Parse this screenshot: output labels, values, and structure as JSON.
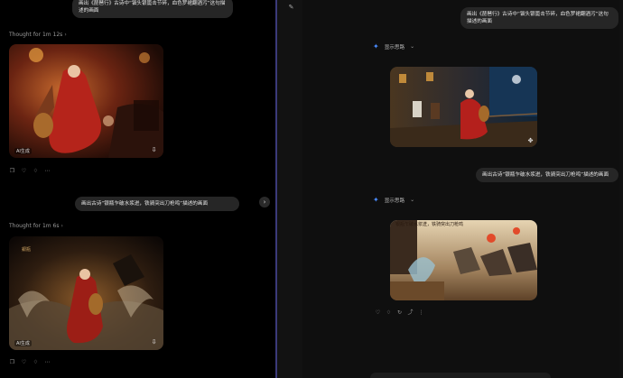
{
  "left": {
    "prompt1": "画出《琵琶行》古诗中“钿头银篦击节碎，血色罗裙翻酒污”这句描述的画面",
    "thought1": "Thought for 1m 12s",
    "thought_chevron": "›",
    "watermark": "AI生成",
    "prompt2": "画出古诗“银瓶乍破水浆迸，铁骑突出刀枪鸣”描述的画面",
    "thought2": "Thought for 1m 6s",
    "side_arrow": "›"
  },
  "right": {
    "prompt1": "画出《琵琶行》古诗中“钿头银篦击节碎，血色罗裙翻酒污”这句描述的画面",
    "show_thinking": "显示思路",
    "prompt2": "画出古诗“银瓶乍破水浆迸，铁骑突出刀枪鸣”描述的画面",
    "show_thinking2": "显示思路",
    "calligraphy": "银瓶乍破水浆迸，铁骑突出刀枪鸣"
  },
  "icons": {
    "copy": "copy-icon",
    "like": "thumb-up-icon",
    "dislike": "thumb-down-icon",
    "more": "more-icon",
    "download": "download-icon",
    "edit": "edit-icon",
    "sparkle": "sparkle-icon",
    "share": "share-icon",
    "regenerate": "regenerate-icon"
  },
  "colors": {
    "accent": "#4a8cff",
    "divider": "#3b3a7a",
    "bubble": "#262626"
  }
}
